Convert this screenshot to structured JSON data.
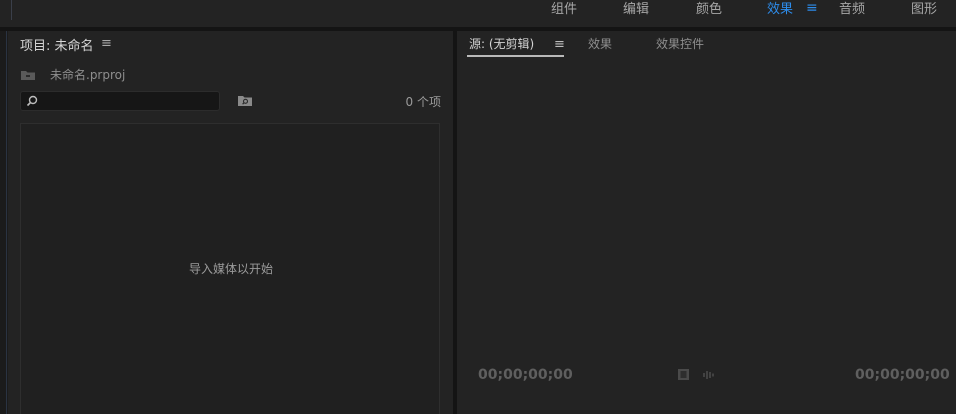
{
  "workspaces": {
    "tabs": [
      {
        "label": "组件",
        "active": false
      },
      {
        "label": "编辑",
        "active": false
      },
      {
        "label": "颜色",
        "active": false
      },
      {
        "label": "效果",
        "active": true
      },
      {
        "label": "音频",
        "active": false
      },
      {
        "label": "图形",
        "active": false
      }
    ],
    "menu_glyph": "≡"
  },
  "project_panel": {
    "title": "项目: 未命名",
    "menu_glyph": "≡",
    "file_name": "未命名.prproj",
    "search_placeholder": "",
    "item_count": "0 个项",
    "empty_message": "导入媒体以开始"
  },
  "source_panel": {
    "tabs": [
      {
        "label": "源: (无剪辑)",
        "active": true
      },
      {
        "label": "效果",
        "active": false
      },
      {
        "label": "效果控件",
        "active": false
      }
    ],
    "menu_glyph": "≡",
    "timecode_left": "00;00;00;00",
    "timecode_right": "00;00;00;00"
  },
  "colors": {
    "accent": "#2d8ceb",
    "panel_bg": "#232323",
    "background": "#1d1d1d"
  }
}
